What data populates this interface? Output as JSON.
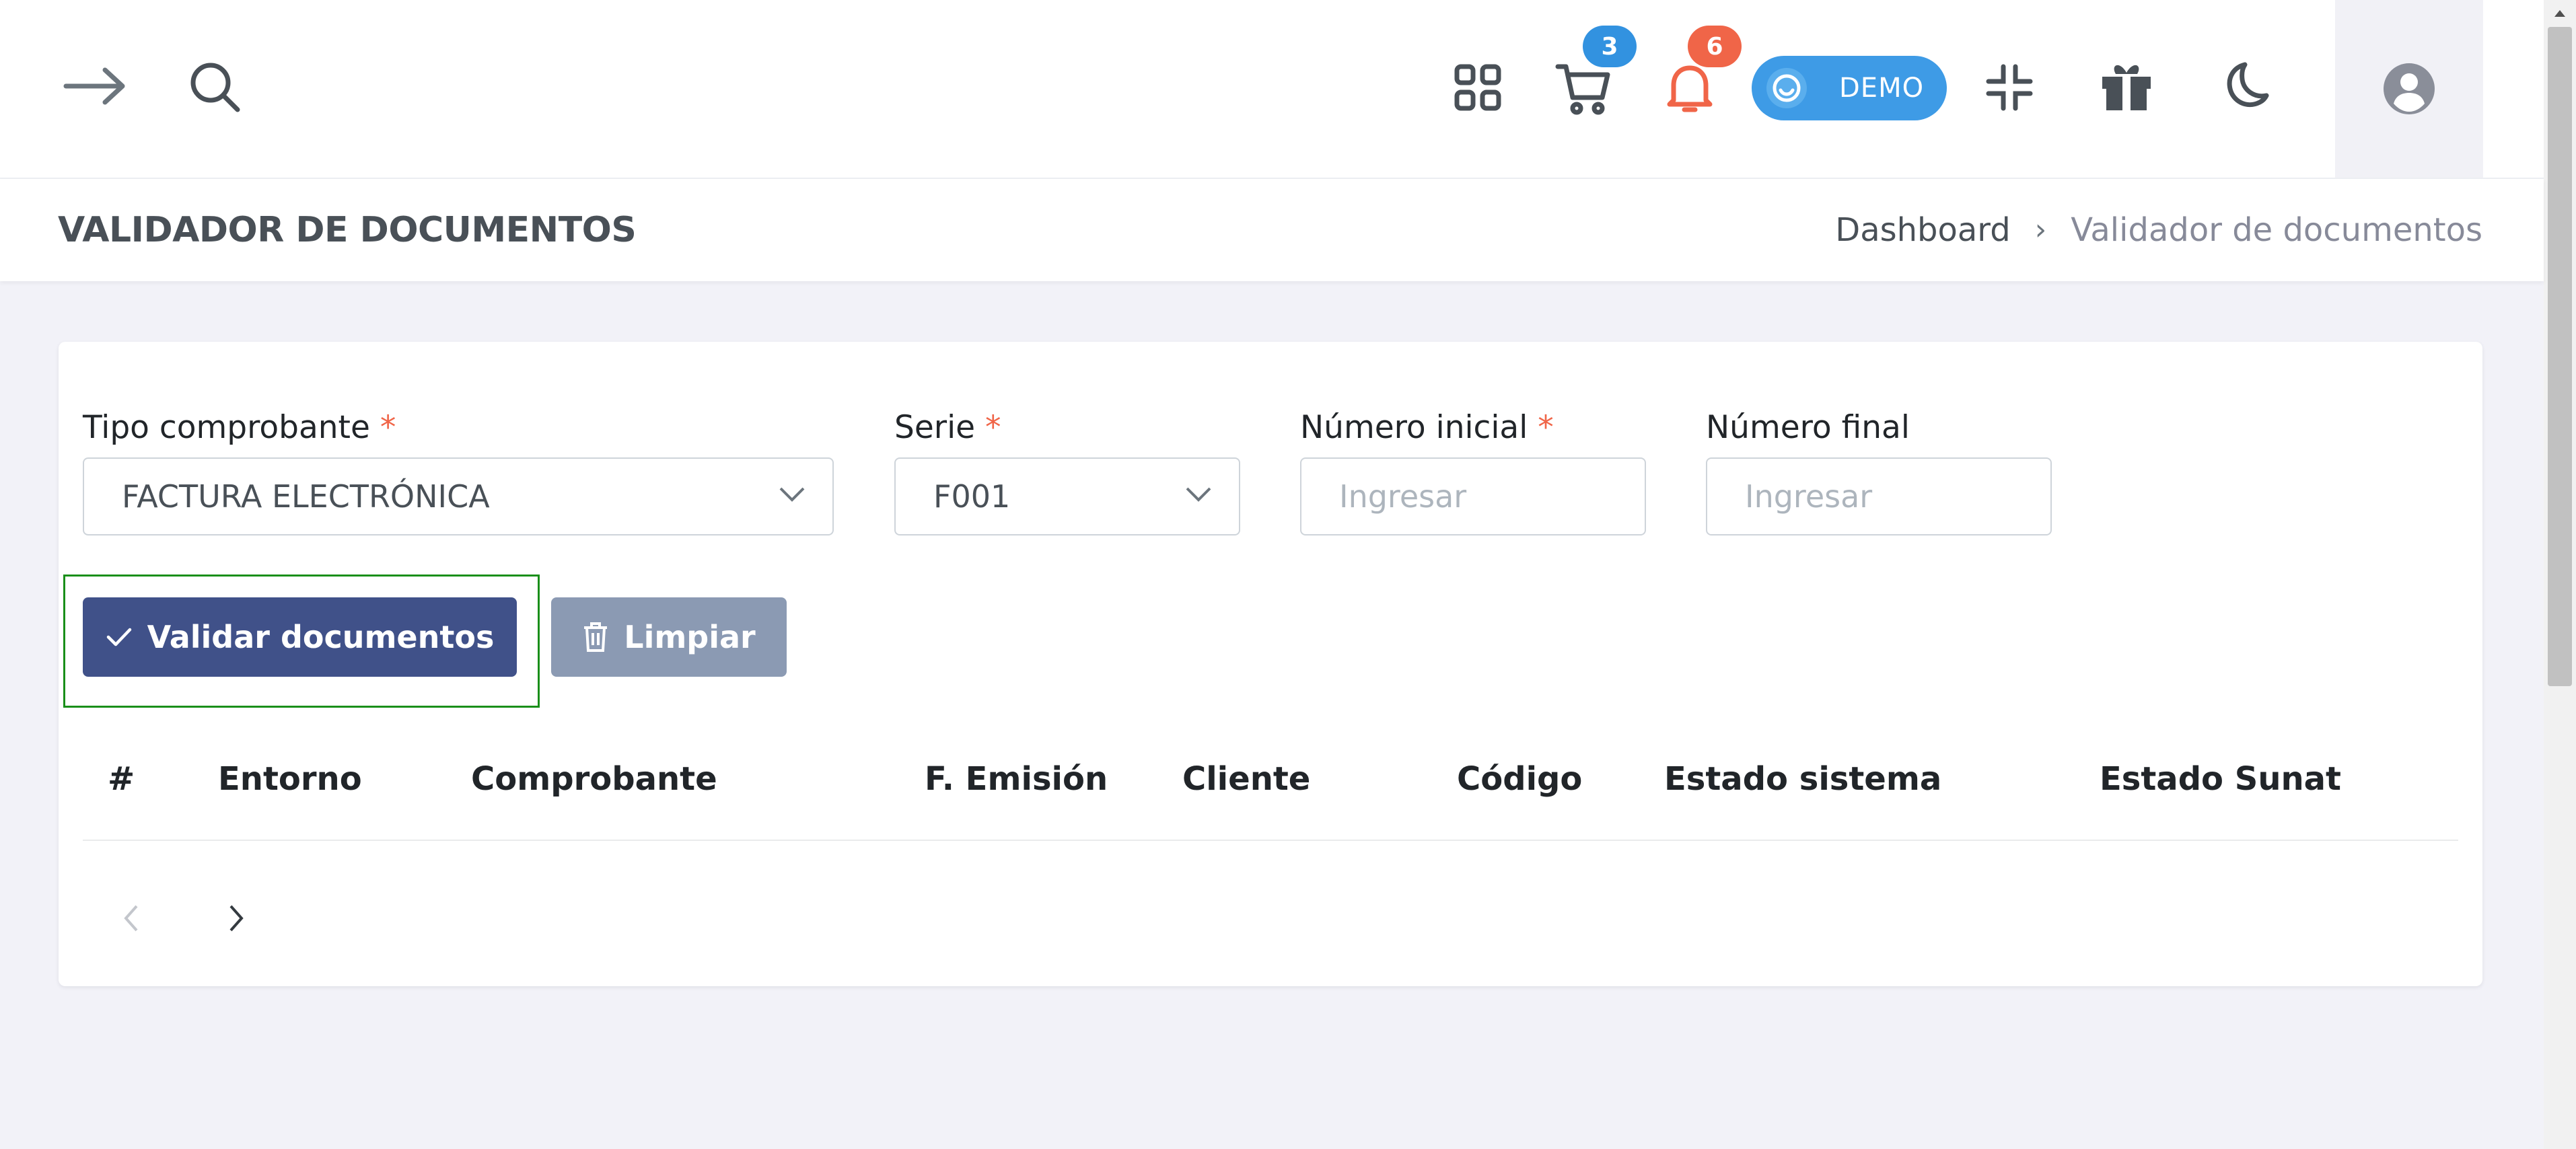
{
  "header": {
    "cart_badge": "3",
    "notifications_badge": "6",
    "demo_label": "DEMO",
    "colors": {
      "cart_badge": "#3292e0",
      "notifications_badge": "#f06548",
      "demo_pill": "#3e9be6"
    }
  },
  "page": {
    "title": "VALIDADOR DE DOCUMENTOS",
    "breadcrumb": {
      "home": "Dashboard",
      "separator": "›",
      "current": "Validador de documentos"
    }
  },
  "form": {
    "tipo_label": "Tipo comprobante",
    "tipo_value": "FACTURA ELECTRÓNICA",
    "serie_label": "Serie",
    "serie_value": "F001",
    "numero_inicial_label": "Número inicial",
    "numero_inicial_placeholder": "Ingresar",
    "numero_final_label": "Número final",
    "numero_final_placeholder": "Ingresar",
    "required_mark": "*"
  },
  "actions": {
    "validate_label": "Validar documentos",
    "clear_label": "Limpiar"
  },
  "table": {
    "columns": [
      "#",
      "Entorno",
      "Comprobante",
      "F. Emisión",
      "Cliente",
      "Código",
      "Estado sistema",
      "Estado Sunat"
    ],
    "rows": []
  },
  "colors": {
    "primary": "#405189",
    "secondary": "#8b9ab3",
    "required": "#f06548",
    "highlight": "#1a8f1a"
  }
}
